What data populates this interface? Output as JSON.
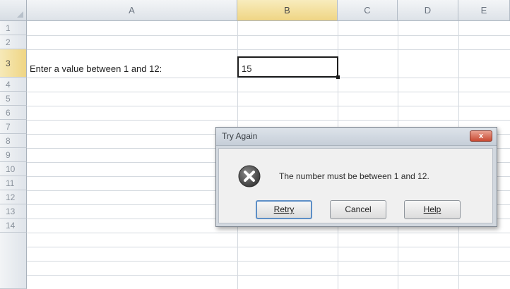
{
  "columns": [
    "A",
    "B",
    "C",
    "D",
    "E"
  ],
  "rows": [
    "1",
    "2",
    "3",
    "4",
    "5",
    "6",
    "7",
    "8",
    "9",
    "10",
    "11",
    "12",
    "13",
    "14"
  ],
  "cells": {
    "A3": "Enter a value between 1 and 12:",
    "B3": "15"
  },
  "active_cell": "B3",
  "dialog": {
    "title": "Try Again",
    "close_label": "x",
    "icon": "error-icon",
    "message": "The number must be between 1 and 12.",
    "buttons": {
      "retry": "Retry",
      "cancel": "Cancel",
      "help": "Help"
    }
  },
  "colors": {
    "active_header": "#efd584",
    "close_button": "#c94a33",
    "error_icon": "#4d4d4d"
  }
}
